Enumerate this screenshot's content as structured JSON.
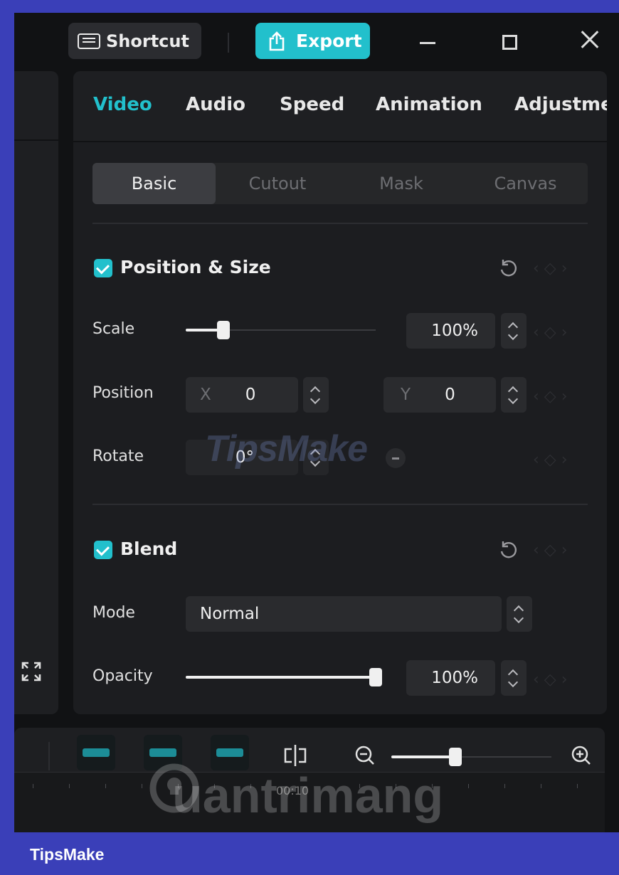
{
  "titlebar": {
    "shortcut_label": "Shortcut",
    "export_label": "Export"
  },
  "tabs": [
    "Video",
    "Audio",
    "Speed",
    "Animation",
    "Adjustme"
  ],
  "subtabs": [
    "Basic",
    "Cutout",
    "Mask",
    "Canvas"
  ],
  "position_size": {
    "title": "Position & Size",
    "scale_label": "Scale",
    "scale_value": "100%",
    "scale_level": 0.2,
    "position_label": "Position",
    "x_axis": "X",
    "x_value": "0",
    "y_axis": "Y",
    "y_value": "0",
    "rotate_label": "Rotate",
    "rotate_value": "0°"
  },
  "blend": {
    "title": "Blend",
    "mode_label": "Mode",
    "mode_value": "Normal",
    "opacity_label": "Opacity",
    "opacity_value": "100%",
    "opacity_level": 1.0
  },
  "timeline": {
    "zoom_level": 0.4,
    "time_label": "00:10"
  },
  "watermarks": {
    "tipsmake": "TipsMake",
    "quantrimang": "uantrimang"
  },
  "footer": {
    "label": "TipsMake"
  },
  "colors": {
    "accent": "#22c0cc",
    "frame": "#3a3fb8",
    "background": "#111214"
  }
}
